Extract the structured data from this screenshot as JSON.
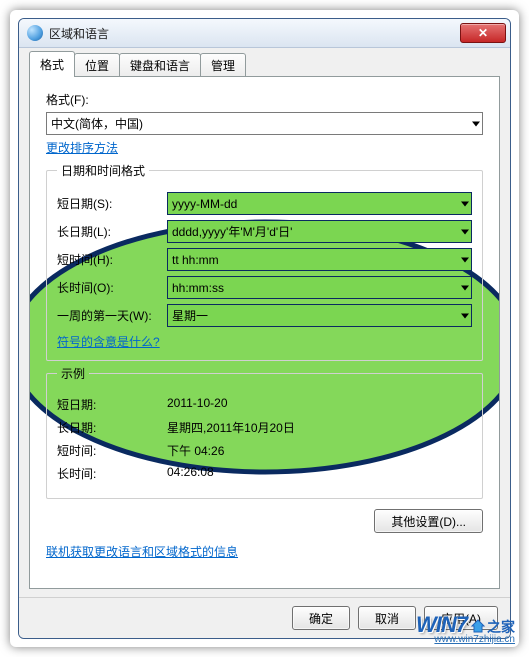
{
  "window": {
    "title": "区域和语言",
    "close_label": "✕"
  },
  "tabs": {
    "format": "格式",
    "location": "位置",
    "keyboards": "键盘和语言",
    "admin": "管理"
  },
  "format_section": {
    "label": "格式(F):",
    "value": "中文(简体，中国)",
    "sort_link": "更改排序方法"
  },
  "datetime_group": {
    "legend": "日期和时间格式",
    "short_date_label": "短日期(S):",
    "short_date_value": "yyyy-MM-dd",
    "long_date_label": "长日期(L):",
    "long_date_value": "dddd,yyyy'年'M'月'd'日'",
    "short_time_label": "短时间(H):",
    "short_time_value": "tt hh:mm",
    "long_time_label": "长时间(O):",
    "long_time_value": "hh:mm:ss",
    "first_day_label": "一周的第一天(W):",
    "first_day_value": "星期一",
    "notation_link": "符号的含意是什么?"
  },
  "examples_group": {
    "legend": "示例",
    "short_date_label": "短日期:",
    "short_date_value": "2011-10-20",
    "long_date_label": "长日期:",
    "long_date_value": "星期四,2011年10月20日",
    "short_time_label": "短时间:",
    "short_time_value": "下午 04:26",
    "long_time_label": "长时间:",
    "long_time_value": "04:26:08"
  },
  "buttons": {
    "additional": "其他设置(D)...",
    "ok": "确定",
    "cancel": "取消",
    "apply": "应用(A)"
  },
  "footer_link": "联机获取更改语言和区域格式的信息",
  "watermark": {
    "logo": "WIN7",
    "suffix": "之家",
    "url": "www.win7zhijia.cn"
  }
}
